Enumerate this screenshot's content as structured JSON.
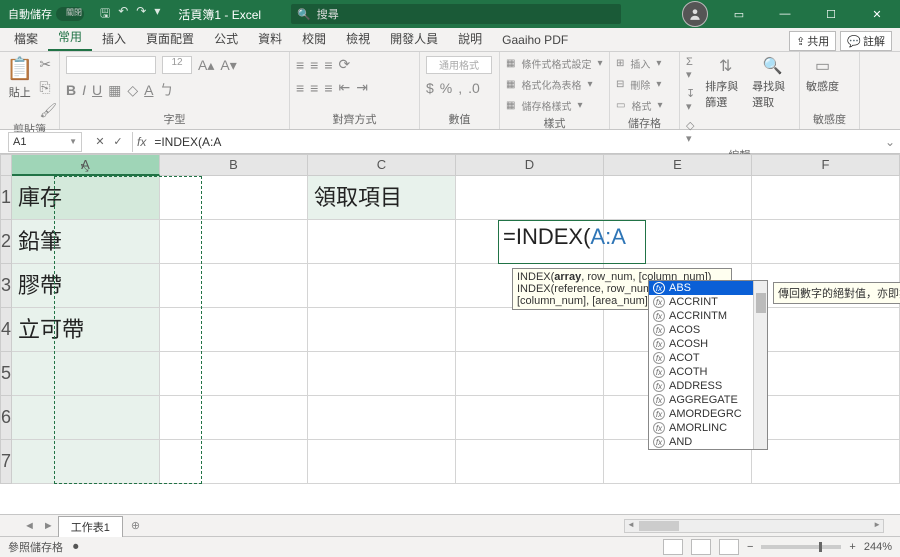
{
  "titlebar": {
    "autosave": "自動儲存",
    "doc": "活頁簿1 - Excel",
    "search_placeholder": "搜尋"
  },
  "tabs": {
    "file": "檔案",
    "home": "常用",
    "insert": "插入",
    "layout": "頁面配置",
    "formulas": "公式",
    "data": "資料",
    "review": "校閱",
    "view": "檢視",
    "developer": "開發人員",
    "help": "說明",
    "gaaiho": "Gaaiho PDF",
    "share": "共用",
    "comments": "註解"
  },
  "ribbon": {
    "clipboard": "剪貼簿",
    "paste": "貼上",
    "font": "字型",
    "fontsize": "12",
    "alignment": "對齊方式",
    "number": "數值",
    "number_fmt": "通用格式",
    "styles": "樣式",
    "s1": "條件式格式設定",
    "s2": "格式化為表格",
    "s3": "儲存格樣式",
    "cells": "儲存格",
    "c1": "插入",
    "c2": "刪除",
    "c3": "格式",
    "editing": "編輯",
    "e1": "排序與篩選",
    "e2": "尋找與選取",
    "sensitivity": "敏感度",
    "sens_btn": "敏感度"
  },
  "namebox": "A1",
  "formula_text": "=INDEX(A:A",
  "columns": [
    "A",
    "B",
    "C",
    "D",
    "E",
    "F"
  ],
  "rows": [
    "1",
    "2",
    "3",
    "4",
    "5",
    "6",
    "7"
  ],
  "cells": {
    "A1": "庫存",
    "A2": "鉛筆",
    "A3": "膠帶",
    "A4": "立可帶",
    "C1": "領取項目",
    "D2_raw": "=INDEX(",
    "D2_ref": "A:A"
  },
  "tooltip": {
    "sig1_pre": "INDEX(",
    "sig1_b": "array",
    "sig1_post": ", row_num, [column_num])",
    "sig2": "INDEX(reference, row_num, [column_num], [area_num])"
  },
  "functions": [
    "ABS",
    "ACCRINT",
    "ACCRINTM",
    "ACOS",
    "ACOSH",
    "ACOT",
    "ACOTH",
    "ADDRESS",
    "AGGREGATE",
    "AMORDEGRC",
    "AMORLINC",
    "AND"
  ],
  "fn_desc": "傳回數字的絕對值，亦即無正",
  "sheettab": "工作表1",
  "status": {
    "mode": "參照儲存格",
    "zoom": "244%"
  }
}
